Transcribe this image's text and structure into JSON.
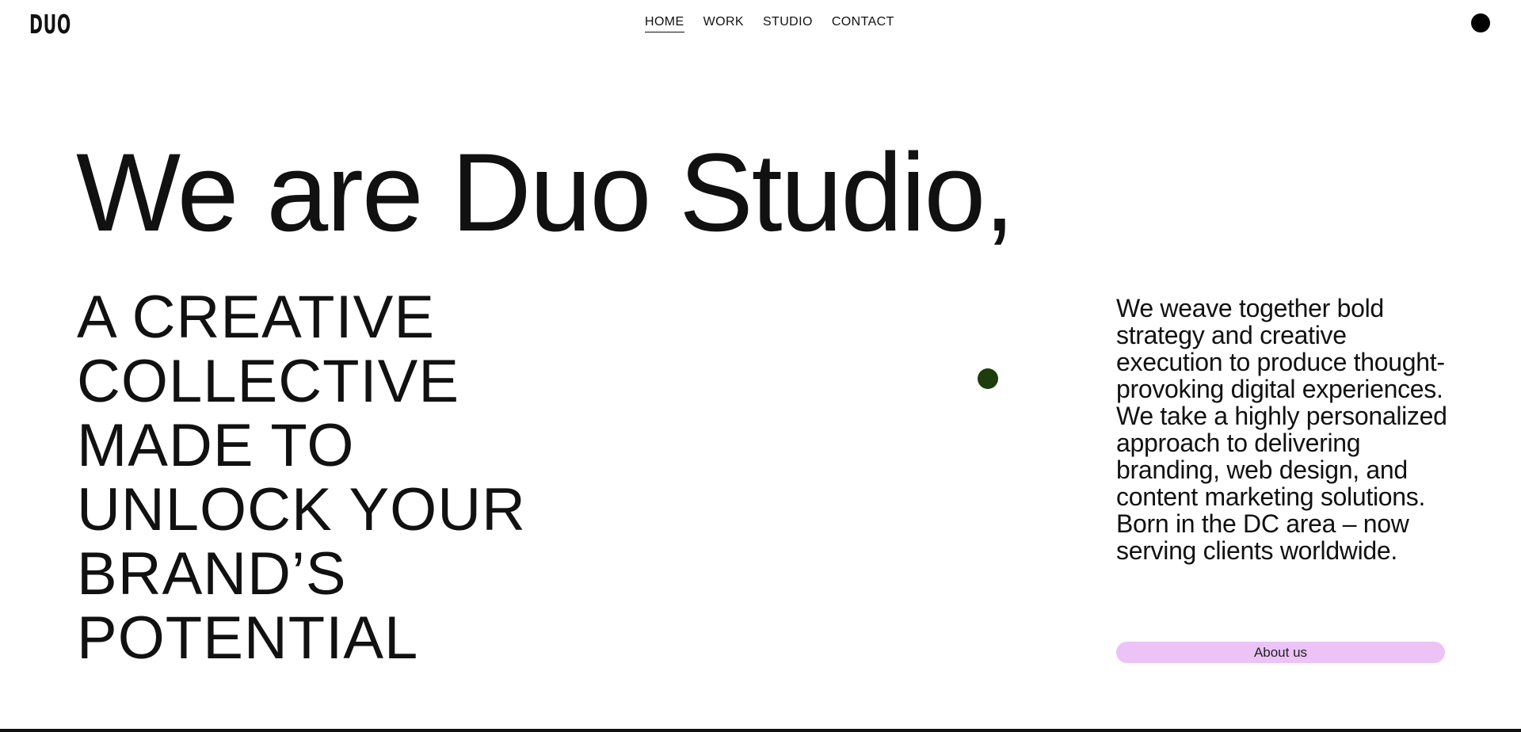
{
  "header": {
    "logo_text": "DUO",
    "nav": [
      {
        "label": "HOME",
        "active": true
      },
      {
        "label": "WORK",
        "active": false
      },
      {
        "label": "STUDIO",
        "active": false
      },
      {
        "label": "CONTACT",
        "active": false
      }
    ],
    "menu_icon": "menu-dot-icon"
  },
  "hero": {
    "title": "We are Duo Studio,",
    "tagline_lines": [
      "A CREATIVE",
      "COLLECTIVE",
      "MADE TO",
      "UNLOCK YOUR",
      "BRAND’S",
      "POTENTIAL"
    ],
    "description": "We weave together bold strategy and creative execution to produce thought-provoking digital experiences. We take a highly personalized approach to delivering branding, web design, and content marketing solutions. Born in the DC area – now serving clients worldwide.",
    "about_button": "About us"
  },
  "colors": {
    "text": "#111111",
    "background": "#ffffff",
    "accent_dot": "#1f3d0c",
    "button_bg": "#ecc3f7"
  }
}
